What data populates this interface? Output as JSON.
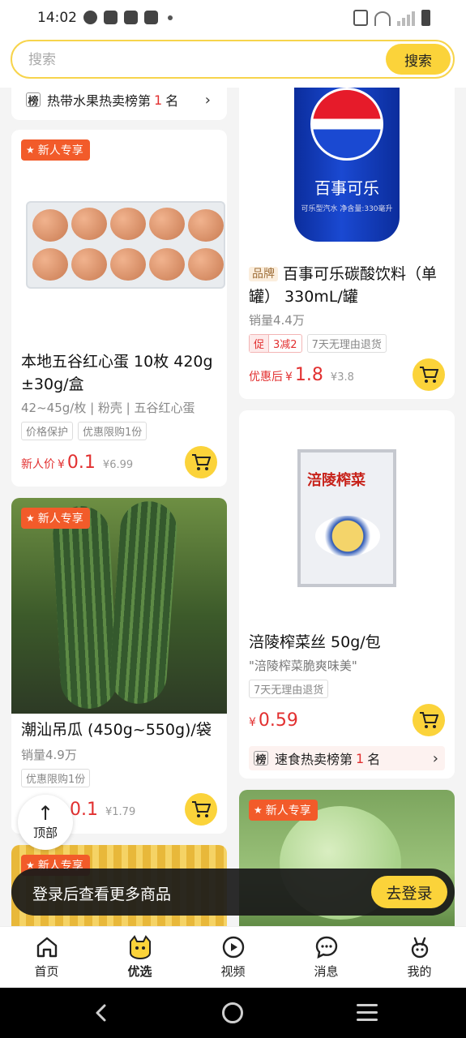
{
  "status_bar": {
    "time": "14:02"
  },
  "search": {
    "placeholder": "搜索",
    "button_label": "搜索"
  },
  "top_rank": {
    "text_before": "热带水果热卖榜第",
    "rank": "1",
    "text_after": "名"
  },
  "products": {
    "eggs": {
      "badge": "新人专享",
      "title": "本地五谷红心蛋 10枚 420g ±30g/盒",
      "spec": "42~45g/枚 | 粉壳 | 五谷红心蛋",
      "tags": [
        "价格保护",
        "优惠限购1份"
      ],
      "price_label": "新人价",
      "currency": "¥",
      "price": "0.1",
      "original_price": "¥6.99"
    },
    "pepsi": {
      "brand_tag": "品牌",
      "title": "百事可乐碳酸饮料（单罐） 330mL/罐",
      "sales": "销量4.4万",
      "promo_key": "促",
      "promo_value": "3减2",
      "tags": [
        "7天无理由退货"
      ],
      "price_label": "优惠后",
      "currency": "¥",
      "price": "1.8",
      "original_price": "¥3.8",
      "can_text": "百事可乐",
      "can_small": "可乐型汽水 净含量:330毫升"
    },
    "pickle": {
      "title": "涪陵榨菜丝 50g/包",
      "quote": "\"涪陵榨菜脆爽味美\"",
      "tags": [
        "7天无理由退货"
      ],
      "currency": "¥",
      "price": "0.59",
      "pack_title": "涪陵榨菜",
      "rank": {
        "text_before": "速食热卖榜第",
        "rank": "1",
        "text_after": "名"
      }
    },
    "melon": {
      "badge": "新人专享",
      "title": "潮汕吊瓜 (450g~550g)/袋",
      "sales": "销量4.9万",
      "tags": [
        "优惠限购1份"
      ],
      "price": "0.1",
      "original_price": "¥1.79"
    },
    "guava": {
      "badge": "新人专享"
    },
    "corn": {
      "badge": "新人专享"
    }
  },
  "back_to_top": {
    "label": "顶部"
  },
  "login_banner": {
    "text": "登录后查看更多商品",
    "button_label": "去登录"
  },
  "tabs": [
    {
      "label": "首页",
      "icon": "home-icon"
    },
    {
      "label": "优选",
      "icon": "mascot-icon"
    },
    {
      "label": "视频",
      "icon": "play-icon"
    },
    {
      "label": "消息",
      "icon": "message-icon"
    },
    {
      "label": "我的",
      "icon": "profile-icon"
    }
  ],
  "colors": {
    "accent": "#fbd33a",
    "price_red": "#e23030",
    "badge_orange": "#f25b2a"
  }
}
